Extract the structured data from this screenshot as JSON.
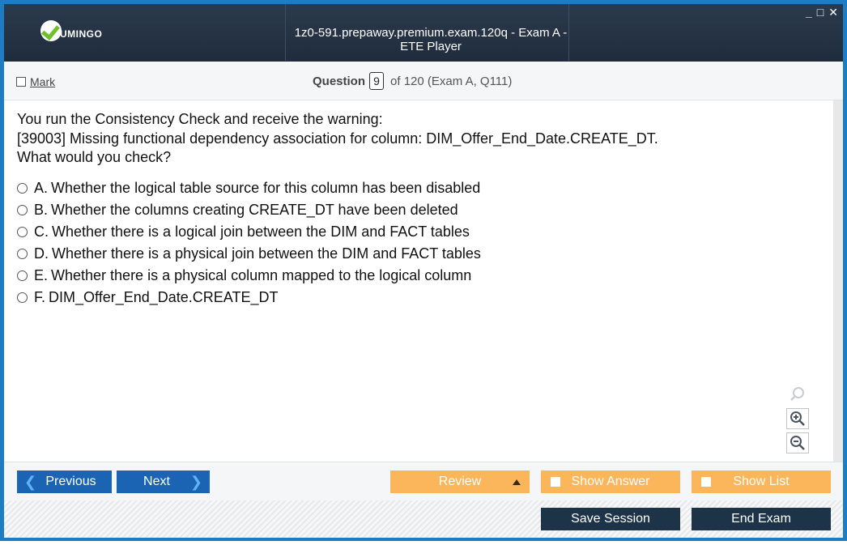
{
  "window": {
    "title": "1z0-591.prepaway.premium.exam.120q - Exam A - ETE Player",
    "logo_text": "UMINGO",
    "controls": [
      "_",
      "□",
      "✕"
    ]
  },
  "header": {
    "mark_label": "Mark",
    "question_label": "Question",
    "question_number": "9",
    "question_of": "of 120 (Exam A, Q111)"
  },
  "question": {
    "lines": [
      "You run the Consistency Check and receive the warning:",
      "[39003] Missing functional dependency association for column: DIM_Offer_End_Date.CREATE_DT.",
      "What would you check?"
    ],
    "answers": [
      {
        "letter": "A.",
        "text": "Whether the logical table source for this column has been disabled"
      },
      {
        "letter": "B.",
        "text": "Whether the columns creating CREATE_DT have been deleted"
      },
      {
        "letter": "C.",
        "text": "Whether there is a logical join between the DIM and FACT tables"
      },
      {
        "letter": "D.",
        "text": "Whether there is a physical join between the DIM and FACT tables"
      },
      {
        "letter": "E.",
        "text": "Whether there is a physical column mapped to the logical column"
      },
      {
        "letter": "F.",
        "text": "DIM_Offer_End_Date.CREATE_DT"
      }
    ]
  },
  "nav": {
    "previous_label": "Previous",
    "next_label": "Next",
    "review_label": "Review",
    "show_answer_label": "Show Answer",
    "show_list_label": "Show List"
  },
  "footer": {
    "save_session_label": "Save Session",
    "end_exam_label": "End Exam"
  },
  "colors": {
    "accent_blue": "#1b64b3",
    "accent_orange": "#fbb55a",
    "dark_navy": "#1c3348",
    "frame_blue": "#1c7cc4"
  }
}
